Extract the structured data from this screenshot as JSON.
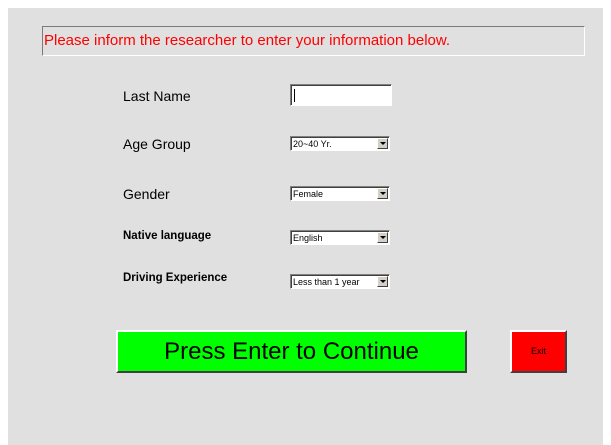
{
  "banner": {
    "text": "Please inform the researcher to enter your information below."
  },
  "form": {
    "last_name": {
      "label": "Last Name",
      "value": ""
    },
    "age_group": {
      "label": "Age Group",
      "value": "20~40 Yr."
    },
    "gender": {
      "label": "Gender",
      "value": "Female"
    },
    "native_language": {
      "label": "Native language",
      "value": "English"
    },
    "driving_experience": {
      "label": "Driving Experience",
      "value": "Less than 1 year"
    }
  },
  "buttons": {
    "continue_label": "Press Enter to Continue",
    "exit_label": "Exit"
  },
  "colors": {
    "banner_text": "#ff0000",
    "continue_bg": "#00ff00",
    "exit_bg": "#ff0000",
    "window_bg": "#e0e0e0"
  },
  "icons": {
    "combo_arrow": "chevron-down-icon",
    "text_caret": "text-caret"
  }
}
